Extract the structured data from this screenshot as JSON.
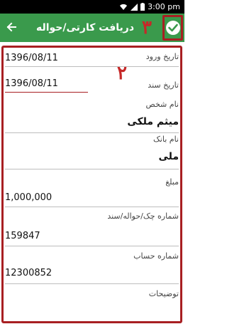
{
  "status_bar": {
    "time": "3:00 pm",
    "icons": [
      "wifi-icon",
      "signal-icon",
      "battery-icon"
    ]
  },
  "app_bar": {
    "title": "دریافت کارتی/حواله",
    "back_icon": "arrow-left-icon",
    "confirm_icon": "check-circle-icon",
    "bg_color": "#3a9a4c"
  },
  "annotations": {
    "confirm_marker": "٣",
    "field_marker": "٢",
    "highlight_color": "#a81f22"
  },
  "form": {
    "entry_date": {
      "label": "تاریخ ورود",
      "value": "1396/08/11"
    },
    "doc_date": {
      "label": "تاریخ سند",
      "value": "1396/08/11"
    },
    "person_name": {
      "label": "نام شخص",
      "value": "میثم ملکی"
    },
    "bank_name": {
      "label": "نام بانک",
      "value": "ملی"
    },
    "amount": {
      "label": "مبلغ",
      "value": "1,000,000"
    },
    "cheque_number": {
      "label": "شماره چک/حواله/سند",
      "value": "159847"
    },
    "account_number": {
      "label": "شماره حساب",
      "value": "12300852"
    },
    "description": {
      "label": "توضیحات",
      "value": ""
    }
  }
}
